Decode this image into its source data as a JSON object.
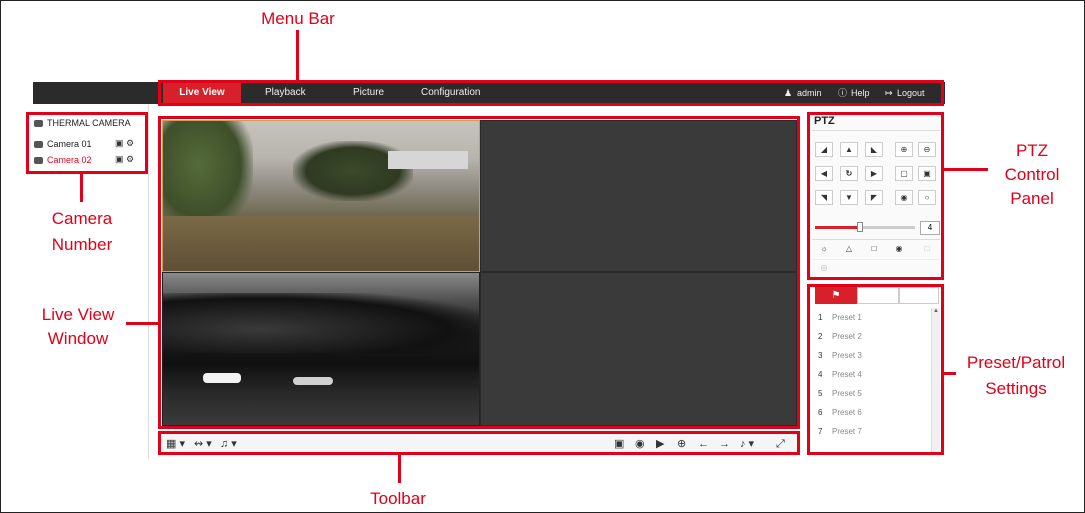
{
  "annotations": {
    "menu_bar": "Menu Bar",
    "camera_number_1": "Camera",
    "camera_number_2": "Number",
    "live_view_1": "Live View",
    "live_view_2": "Window",
    "toolbar": "Toolbar",
    "ptz_1": "PTZ",
    "ptz_2": "Control",
    "ptz_3": "Panel",
    "preset_1": "Preset/Patrol",
    "preset_2": "Settings"
  },
  "menu": {
    "tabs": [
      "Live View",
      "Playback",
      "Picture",
      "Configuration"
    ],
    "active_tab": "Live View",
    "user": "admin",
    "help": "Help",
    "logout": "Logout"
  },
  "device_tree": {
    "root": "THERMAL CAMERA",
    "cameras": [
      {
        "label": "Camera 01",
        "selected": false
      },
      {
        "label": "Camera 02",
        "selected": true
      }
    ]
  },
  "ptz": {
    "title": "PTZ",
    "speed": "4",
    "speed_fraction": 0.45
  },
  "presets": {
    "items": [
      {
        "num": "1",
        "label": "Preset 1"
      },
      {
        "num": "2",
        "label": "Preset 2"
      },
      {
        "num": "3",
        "label": "Preset 3"
      },
      {
        "num": "4",
        "label": "Preset 4"
      },
      {
        "num": "5",
        "label": "Preset 5"
      },
      {
        "num": "6",
        "label": "Preset 6"
      },
      {
        "num": "7",
        "label": "Preset 7"
      }
    ]
  },
  "colors": {
    "accent": "#d8202a",
    "annotation": "#e0001a",
    "menubar": "#2b2b2b"
  }
}
